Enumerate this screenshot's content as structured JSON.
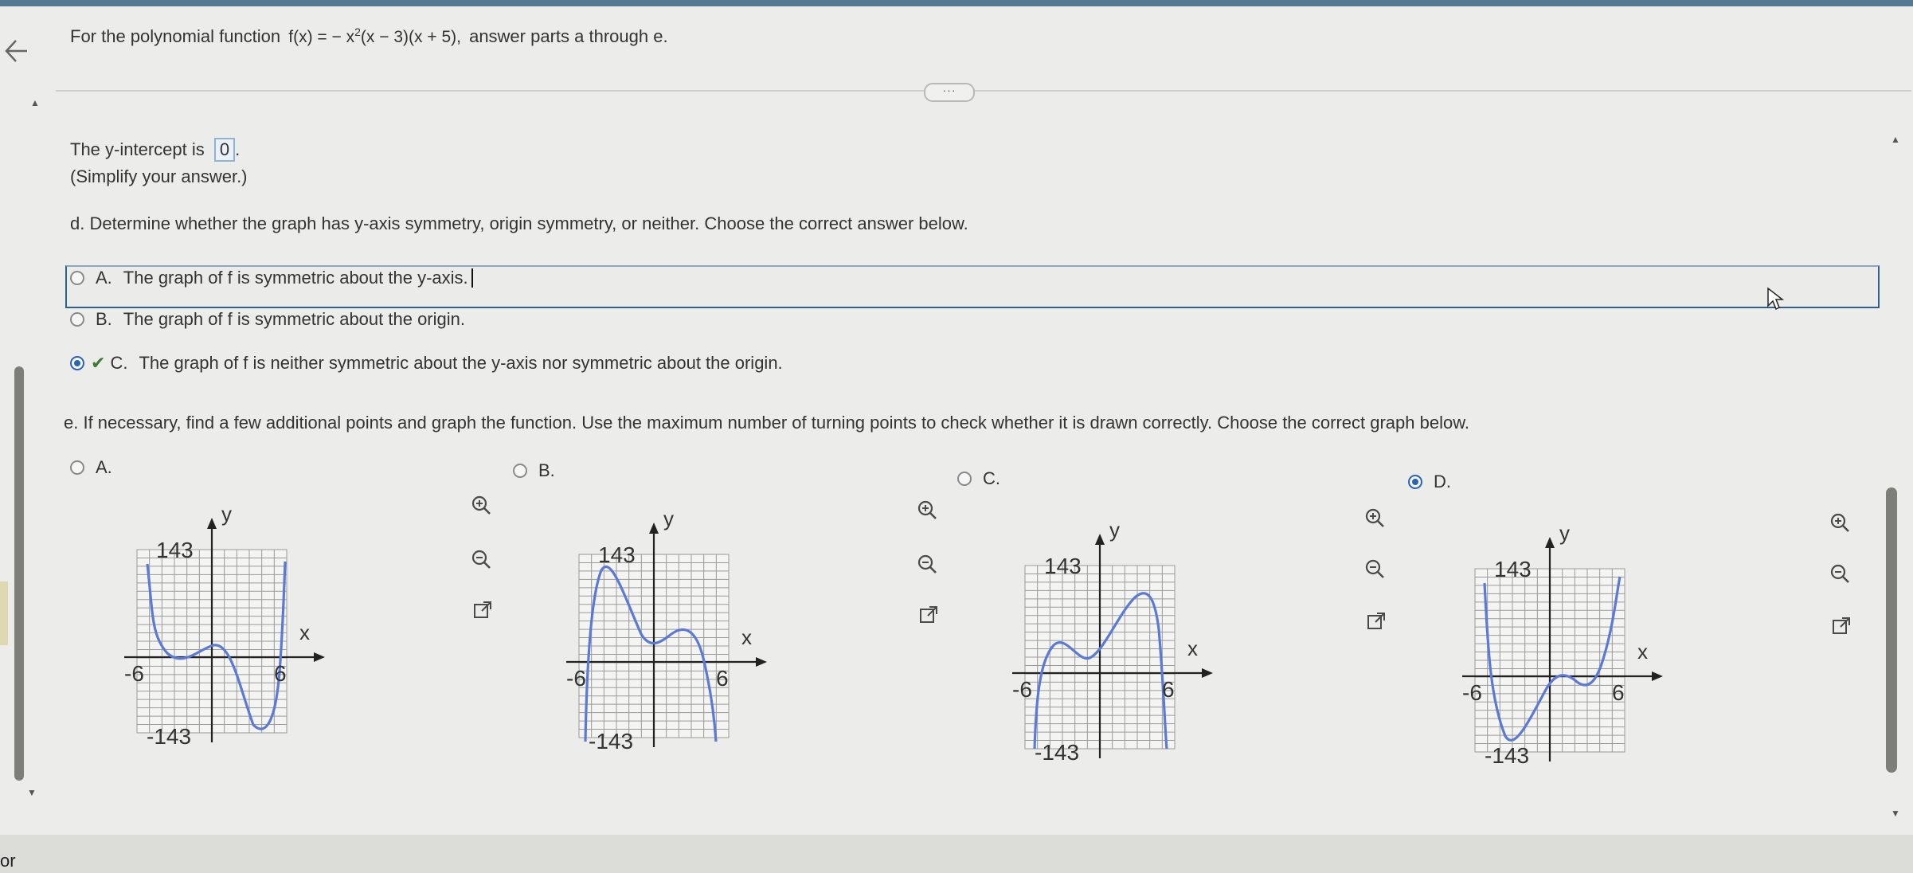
{
  "question": {
    "prefix": "For the polynomial function",
    "function_text": "f(x) = − x",
    "function_exp": "2",
    "function_rest": "(x − 3)(x + 5),",
    "suffix": "answer parts a through e."
  },
  "divider_handle": "···",
  "y_intercept": {
    "label": "The y-intercept is",
    "value": "0",
    "end": ".",
    "note": "(Simplify your answer.)"
  },
  "part_d": {
    "prompt": "d. Determine whether the graph has y-axis symmetry, origin symmetry, or neither. Choose the correct answer below.",
    "options": [
      {
        "letter": "A.",
        "text": "The graph of f is symmetric about the y-axis."
      },
      {
        "letter": "B.",
        "text": "The graph of f is symmetric about the origin."
      },
      {
        "letter": "C.",
        "text": "The graph of f is neither symmetric about the y-axis nor symmetric about the origin."
      }
    ],
    "selected": "C"
  },
  "part_e": {
    "prompt": "e. If necessary, find a few additional points and graph the function. Use the maximum number of turning points to check whether it is drawn correctly. Choose the correct graph below.",
    "choices": [
      {
        "letter": "A.",
        "selected": false
      },
      {
        "letter": "B.",
        "selected": false
      },
      {
        "letter": "C.",
        "selected": false
      },
      {
        "letter": "D.",
        "selected": true
      }
    ]
  },
  "graph_labels": {
    "y": "y",
    "x": "x",
    "ymax": "143",
    "ymin": "-143",
    "xmin": "-6",
    "xmax": "6"
  },
  "icons": {
    "back": "back-arrow-icon",
    "zoom_in": "zoom-in-icon",
    "zoom_out": "zoom-out-icon",
    "popout": "external-link-icon"
  },
  "colors": {
    "curve": "#5b79d6",
    "selection_border": "#2f5f8e",
    "radio_selected": "#2c64b5",
    "check": "#3f7a35",
    "answer_box": "#8fb3d6"
  },
  "bottom_text": "or"
}
